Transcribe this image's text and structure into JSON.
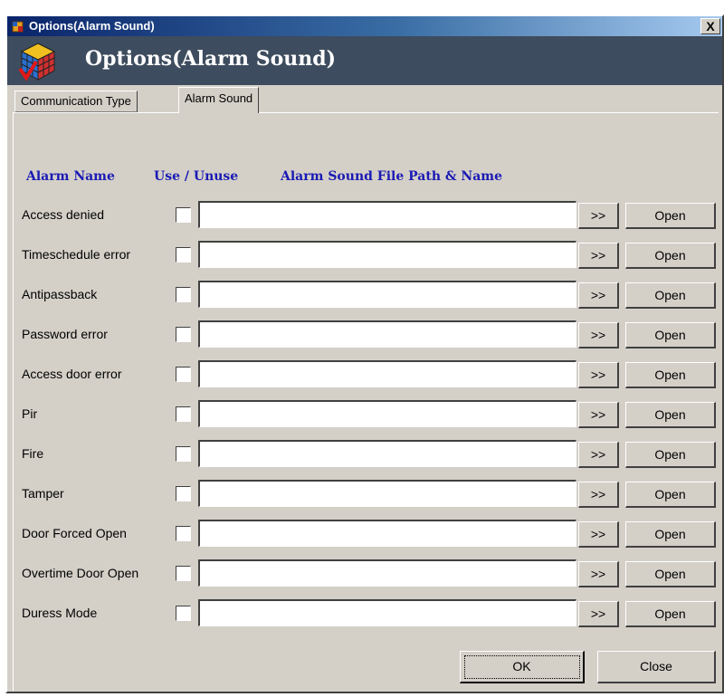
{
  "window": {
    "title": "Options(Alarm Sound)",
    "close_glyph": "X"
  },
  "header": {
    "title": "Options(Alarm Sound)",
    "icon": "rubiks-cube-check-icon"
  },
  "tabs": [
    {
      "label": "Communication Type",
      "active": false
    },
    {
      "label": "Alarm Sound",
      "active": true
    }
  ],
  "columns": {
    "name": "Alarm Name",
    "use": "Use / Unuse",
    "path": "Alarm Sound File Path & Name"
  },
  "rows": [
    {
      "name": "Access denied",
      "checked": false,
      "path": "",
      "browse": ">>",
      "open": "Open"
    },
    {
      "name": "Timeschedule error",
      "checked": false,
      "path": "",
      "browse": ">>",
      "open": "Open"
    },
    {
      "name": "Antipassback",
      "checked": false,
      "path": "",
      "browse": ">>",
      "open": "Open"
    },
    {
      "name": "Password error",
      "checked": false,
      "path": "",
      "browse": ">>",
      "open": "Open"
    },
    {
      "name": "Access door error",
      "checked": false,
      "path": "",
      "browse": ">>",
      "open": "Open"
    },
    {
      "name": "Pir",
      "checked": false,
      "path": "",
      "browse": ">>",
      "open": "Open"
    },
    {
      "name": "Fire",
      "checked": false,
      "path": "",
      "browse": ">>",
      "open": "Open"
    },
    {
      "name": "Tamper",
      "checked": false,
      "path": "",
      "browse": ">>",
      "open": "Open"
    },
    {
      "name": "Door Forced Open",
      "checked": false,
      "path": "",
      "browse": ">>",
      "open": "Open"
    },
    {
      "name": "Overtime Door Open",
      "checked": false,
      "path": "",
      "browse": ">>",
      "open": "Open"
    },
    {
      "name": "Duress Mode",
      "checked": false,
      "path": "",
      "browse": ">>",
      "open": "Open"
    }
  ],
  "footer": {
    "ok": "OK",
    "close": "Close"
  },
  "colors": {
    "title_gradient_start": "#0a246a",
    "header_band": "#3d4c5e",
    "column_header": "#1a1ab4",
    "dialog_face": "#d4d0c8"
  }
}
